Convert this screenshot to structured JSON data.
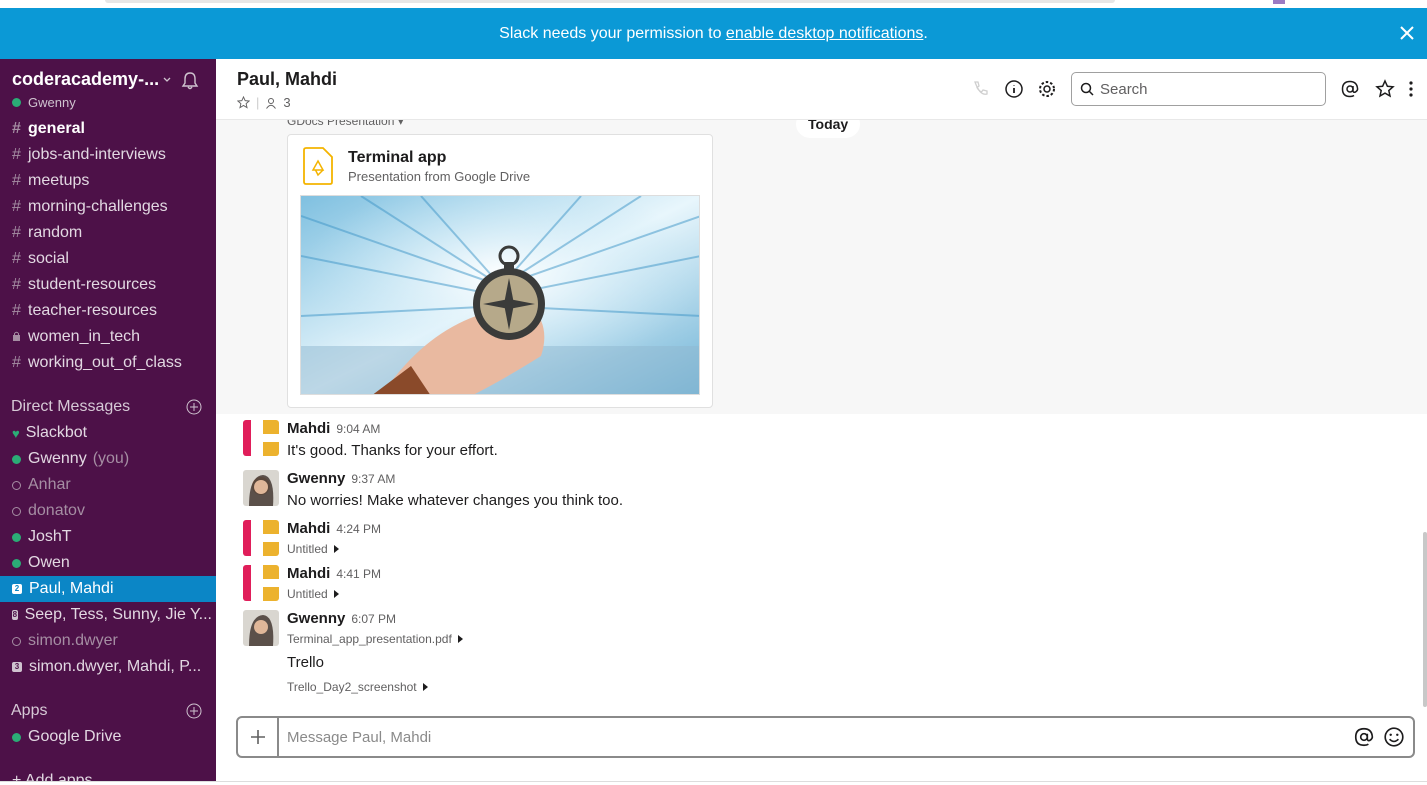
{
  "banner": {
    "prefix": "Slack needs your permission to",
    "link": "enable desktop notifications",
    "suffix": "."
  },
  "sidebar": {
    "team_name": "coderacademy-...",
    "user": "Gwenny",
    "channels": [
      {
        "name": "general",
        "type": "public",
        "bold": true
      },
      {
        "name": "jobs-and-interviews",
        "type": "public"
      },
      {
        "name": "meetups",
        "type": "public"
      },
      {
        "name": "morning-challenges",
        "type": "public"
      },
      {
        "name": "random",
        "type": "public"
      },
      {
        "name": "social",
        "type": "public"
      },
      {
        "name": "student-resources",
        "type": "public"
      },
      {
        "name": "teacher-resources",
        "type": "public"
      },
      {
        "name": "women_in_tech",
        "type": "private"
      },
      {
        "name": "working_out_of_class",
        "type": "public"
      }
    ],
    "direct_messages_label": "Direct Messages",
    "dms": [
      {
        "name": "Slackbot",
        "status": "heart"
      },
      {
        "name": "Gwenny",
        "suffix": "(you)",
        "status": "online"
      },
      {
        "name": "Anhar",
        "status": "away"
      },
      {
        "name": "donatov",
        "status": "away"
      },
      {
        "name": "JoshT",
        "status": "online"
      },
      {
        "name": "Owen",
        "status": "online"
      },
      {
        "name": "Paul, Mahdi",
        "status": "group",
        "count": "2",
        "active": true
      },
      {
        "name": "Seep, Tess, Sunny, Jie Y...",
        "status": "group",
        "count": "8"
      },
      {
        "name": "simon.dwyer",
        "status": "away"
      },
      {
        "name": "simon.dwyer, Mahdi, P...",
        "status": "group",
        "count": "3"
      }
    ],
    "apps_label": "Apps",
    "apps": [
      {
        "name": "Google Drive",
        "status": "online"
      }
    ],
    "add_apps": "+ Add apps"
  },
  "header": {
    "title": "Paul, Mahdi",
    "members": "3",
    "search_placeholder": "Search"
  },
  "messages": {
    "today": "Today",
    "gdocs_label": "GDocs Presentation",
    "card": {
      "title": "Terminal app",
      "subtitle": "Presentation from Google Drive"
    },
    "items": [
      {
        "author": "Mahdi",
        "time": "9:04 AM",
        "text": "It's good. Thanks for your effort."
      },
      {
        "author": "Gwenny",
        "time": "9:37 AM",
        "text": "No worries! Make whatever changes you think too."
      },
      {
        "author": "Mahdi",
        "time": "4:24 PM",
        "file": "Untitled"
      },
      {
        "author": "Mahdi",
        "time": "4:41 PM",
        "file": "Untitled"
      },
      {
        "author": "Gwenny",
        "time": "6:07 PM",
        "file": "Terminal_app_presentation.pdf",
        "text": "Trello",
        "file2": "Trello_Day2_screenshot"
      }
    ]
  },
  "composer": {
    "placeholder": "Message Paul, Mahdi"
  },
  "colors": {
    "sidebar": "#4d1148",
    "banner": "#0b99d6",
    "active": "#0b86c6",
    "online": "#2bac76"
  }
}
